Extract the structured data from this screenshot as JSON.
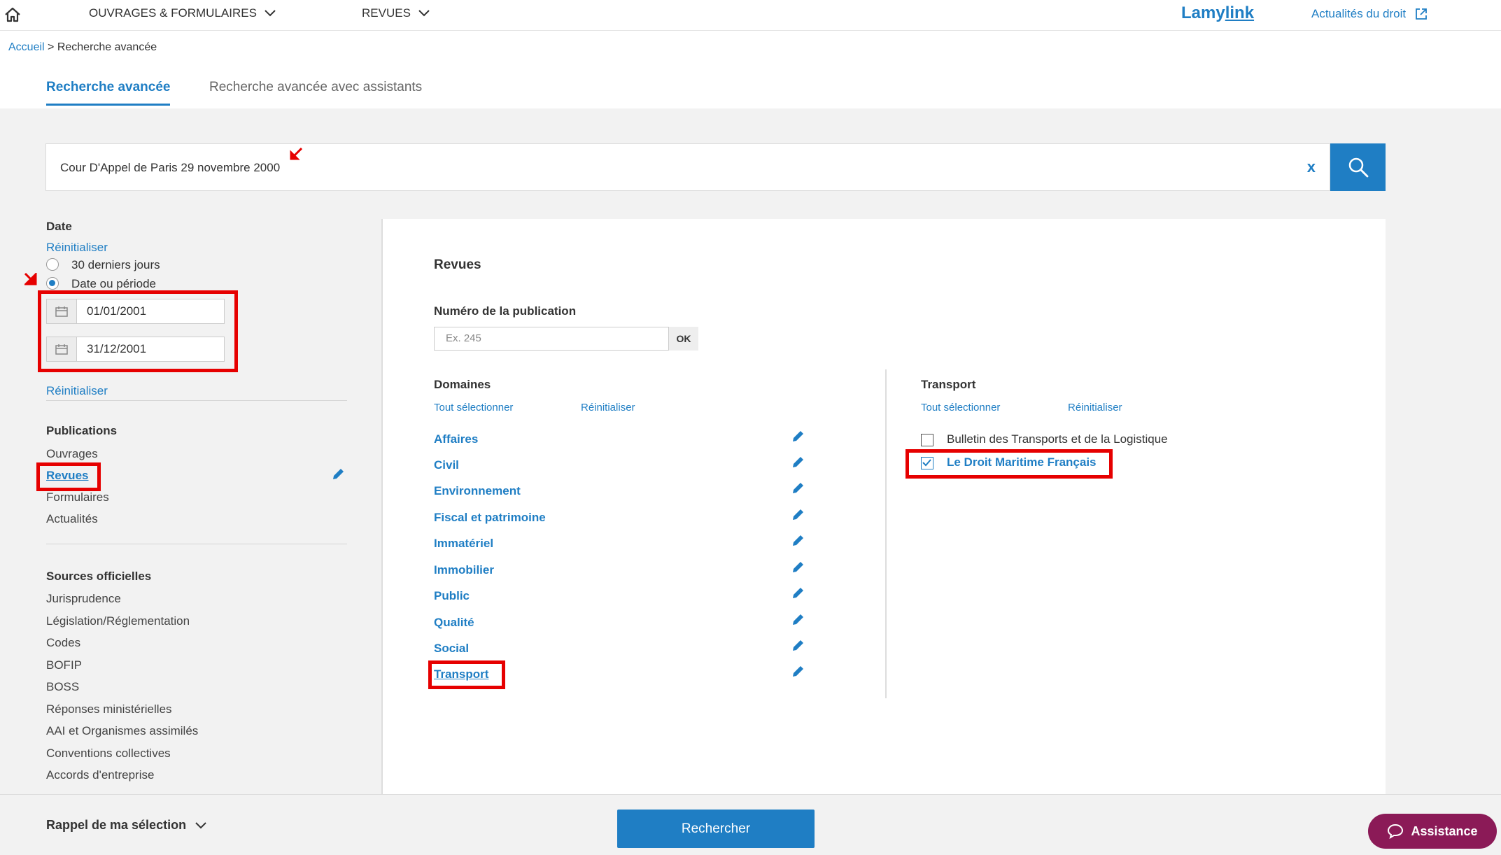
{
  "nav": {
    "items": [
      "OUVRAGES & FORMULAIRES",
      "REVUES"
    ],
    "brand_a": "Lamy",
    "brand_b": "link",
    "news": "Actualités du droit"
  },
  "breadcrumb": {
    "home": "Accueil",
    "sep": " > ",
    "current": "Recherche avancée"
  },
  "tabs": [
    {
      "label": "Recherche avancée",
      "active": true
    },
    {
      "label": "Recherche avancée avec assistants",
      "active": false
    }
  ],
  "search": {
    "value": "Cour D'Appel de Paris 29 novembre 2000",
    "clear": "x"
  },
  "sidebar": {
    "date": {
      "title": "Date",
      "reset_top": "Réinitialiser",
      "options": [
        {
          "label": "30 derniers jours",
          "selected": false
        },
        {
          "label": "Date ou période",
          "selected": true
        }
      ],
      "from": "01/01/2001",
      "to": "31/12/2001",
      "reset_bottom": "Réinitialiser"
    },
    "publications": {
      "title": "Publications",
      "items": [
        "Ouvrages",
        "Revues",
        "Formulaires",
        "Actualités"
      ],
      "selected": "Revues"
    },
    "sources": {
      "title": "Sources officielles",
      "items": [
        "Jurisprudence",
        "Législation/Réglementation",
        "Codes",
        "BOFIP",
        "BOSS",
        "Réponses ministérielles",
        "AAI et Organismes assimilés",
        "Conventions collectives",
        "Accords d'entreprise"
      ]
    }
  },
  "panel": {
    "title": "Revues",
    "pub_number_label": "Numéro de la publication",
    "pub_number_placeholder": "Ex. 245",
    "ok": "OK",
    "domains": {
      "title": "Domaines",
      "select_all": "Tout sélectionner",
      "reset": "Réinitialiser",
      "items": [
        "Affaires",
        "Civil",
        "Environnement",
        "Fiscal et patrimoine",
        "Immatériel",
        "Immobilier",
        "Public",
        "Qualité",
        "Social",
        "Transport"
      ],
      "selected": "Transport"
    },
    "transport": {
      "title": "Transport",
      "select_all": "Tout sélectionner",
      "reset": "Réinitialiser",
      "journals": [
        {
          "label": "Bulletin des Transports et de la Logistique",
          "checked": false
        },
        {
          "label": "Le Droit Maritime Français",
          "checked": true
        }
      ]
    }
  },
  "bottom": {
    "recap": "Rappel de ma sélection",
    "search_button": "Rechercher",
    "assist": "Assistance"
  },
  "colors": {
    "accent": "#1f7ec4",
    "highlight": "#e60000",
    "assist": "#8b1a57"
  },
  "icons": [
    "home-icon",
    "chevron-down-icon",
    "external-link-icon",
    "search-icon",
    "calendar-icon",
    "pencil-icon",
    "chat-icon"
  ]
}
